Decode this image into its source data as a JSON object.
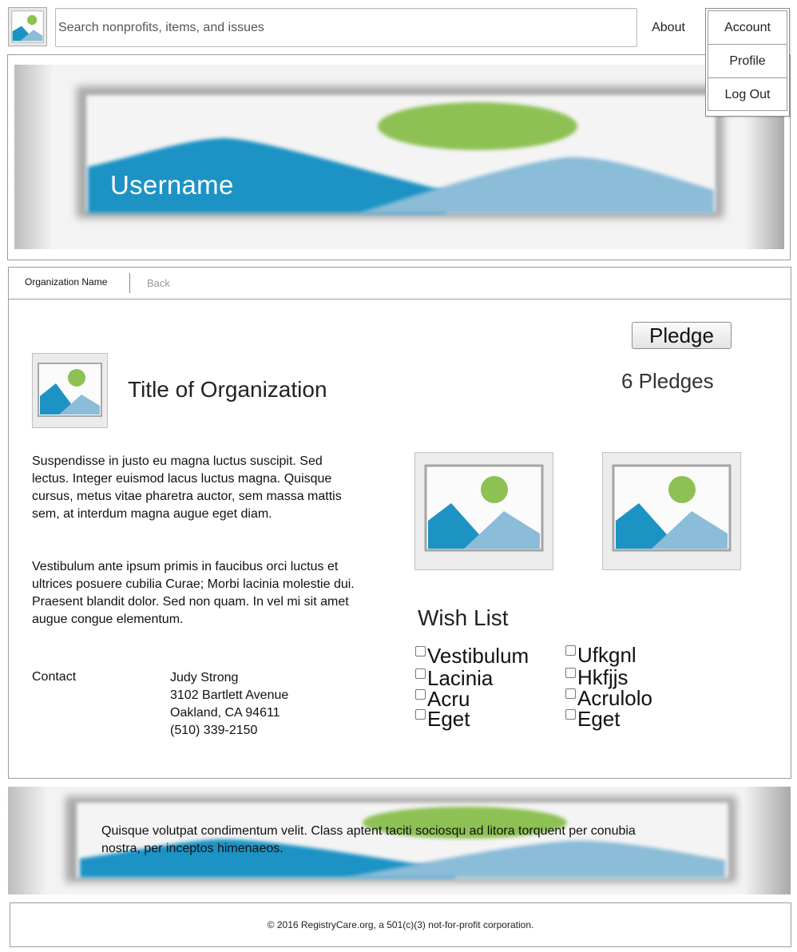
{
  "header": {
    "logo_icon": "image-placeholder-icon",
    "search_placeholder": "Search nonprofits, items, and issues",
    "about_label": "About"
  },
  "account_menu": {
    "items": [
      "Account",
      "Profile",
      "Log Out"
    ]
  },
  "banner": {
    "username": "Username"
  },
  "tabs": {
    "organization": "Organization Name",
    "back": "Back"
  },
  "organization": {
    "title": "Title of Organization",
    "pledge_label": "Pledge",
    "pledge_count": "6 Pledges",
    "description": [
      "Suspendisse in justo eu magna luctus suscipit. Sed lectus. Integer euismod lacus luctus magna. Quisque cursus, metus vitae pharetra auctor, sem massa mattis sem, at interdum magna augue eget diam.",
      "Vestibulum ante ipsum primis in faucibus orci luctus et ultrices posuere cubilia Curae; Morbi lacinia molestie dui. Praesent blandit dolor. Sed non quam. In vel mi sit amet augue congue elementum."
    ],
    "contact_label": "Contact",
    "contact": [
      "Judy Strong",
      "3102 Bartlett Avenue",
      "Oakland, CA 94611",
      "(510) 339-2150"
    ]
  },
  "wish_list": {
    "title": "Wish List",
    "left": [
      "Vestibulum",
      "Lacinia",
      "Acru",
      "Eget"
    ],
    "right": [
      "Ufkgnl",
      "Hkfjjs",
      "Acrulolo",
      "Eget"
    ]
  },
  "footer": {
    "banner_text": "Quisque volutpat condimentum velit. Class aptent taciti sociosqu ad litora torquent per conubia nostra, per inceptos himenaeos.",
    "copyright": "© 2016 RegistryCare.org, a 501(c)(3) not-for-profit corporation."
  },
  "colors": {
    "mountain_dark": "#1d93c4",
    "mountain_light": "#8bbcd8",
    "sun": "#8dc153",
    "frame": "#cfcfcf"
  }
}
